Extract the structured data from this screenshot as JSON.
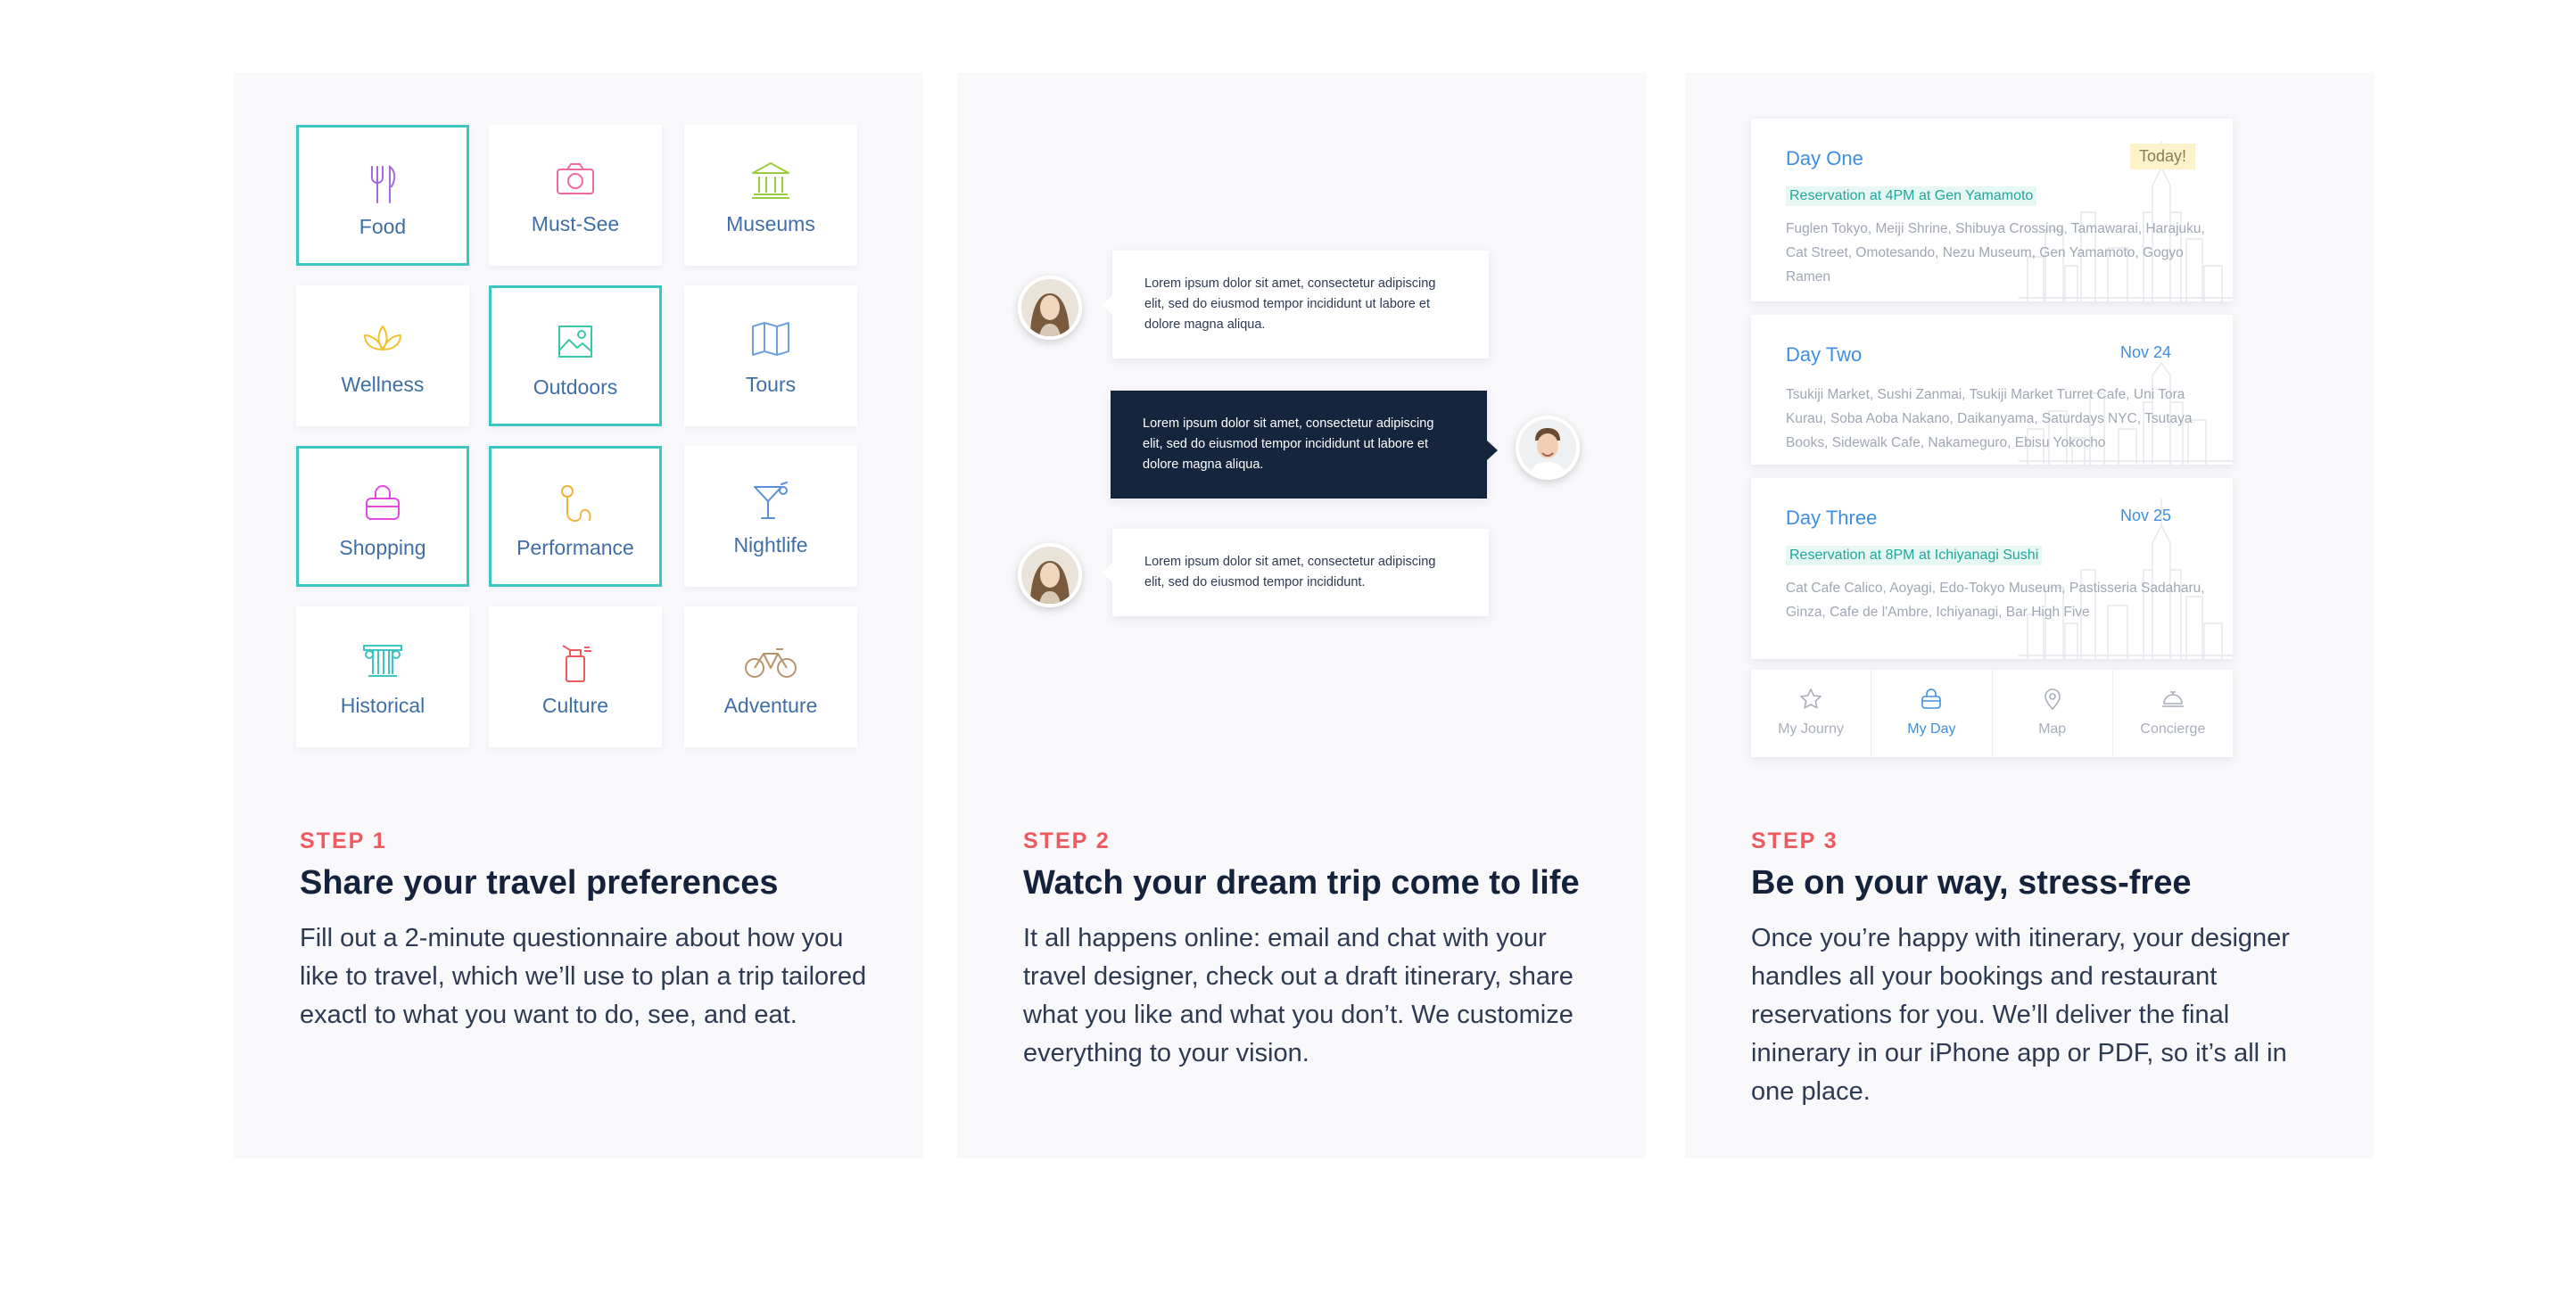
{
  "steps": [
    {
      "label": "STEP 1",
      "title": "Share your travel preferences",
      "description": "Fill out a 2-minute questionnaire about how you like to travel, which we’ll use to plan a trip tailored exactl to what you want to do, see, and eat."
    },
    {
      "label": "STEP 2",
      "title": "Watch your dream trip come to life",
      "description": "It all happens online: email and chat with your travel designer, check out a draft itinerary, share what you like and what you don’t. We customize everything to your vision."
    },
    {
      "label": "STEP 3",
      "title": "Be on your way, stress-free",
      "description": "Once you’re happy with itinerary, your designer handles all your bookings and restaurant reservations for you. We’ll deliver the final ininerary in our iPhone app or PDF, so it’s all in one place."
    }
  ],
  "categories": [
    {
      "label": "Food",
      "icon": "fork-knife-icon",
      "selected": true,
      "color": "#a36ae0"
    },
    {
      "label": "Must-See",
      "icon": "camera-icon",
      "selected": false,
      "color": "#f06aa0"
    },
    {
      "label": "Museums",
      "icon": "museum-icon",
      "selected": false,
      "color": "#9ccc3c"
    },
    {
      "label": "Wellness",
      "icon": "lotus-icon",
      "selected": false,
      "color": "#f2c22c"
    },
    {
      "label": "Outdoors",
      "icon": "landscape-icon",
      "selected": true,
      "color": "#3cc6a8"
    },
    {
      "label": "Tours",
      "icon": "map-icon",
      "selected": false,
      "color": "#6fa0e0"
    },
    {
      "label": "Shopping",
      "icon": "handbag-icon",
      "selected": true,
      "color": "#e44ae0"
    },
    {
      "label": "Performance",
      "icon": "microphone-icon",
      "selected": true,
      "color": "#f2b23c"
    },
    {
      "label": "Nightlife",
      "icon": "cocktail-icon",
      "selected": false,
      "color": "#5a8fd6"
    },
    {
      "label": "Historical",
      "icon": "column-icon",
      "selected": false,
      "color": "#3cc6c1"
    },
    {
      "label": "Culture",
      "icon": "spray-can-icon",
      "selected": false,
      "color": "#ef5a5f"
    },
    {
      "label": "Adventure",
      "icon": "bicycle-icon",
      "selected": false,
      "color": "#b8946a"
    }
  ],
  "chat": {
    "messages": [
      {
        "from": "traveler",
        "avatar_icon": "woman-avatar",
        "text": "Lorem ipsum dolor sit amet, consectetur adipiscing elit, sed do eiusmod tempor incididunt ut labore et dolore magna aliqua."
      },
      {
        "from": "designer",
        "avatar_icon": "man-avatar",
        "text": "Lorem ipsum dolor sit amet, consectetur adipiscing elit, sed do eiusmod tempor incididunt ut labore et dolore magna aliqua."
      },
      {
        "from": "traveler",
        "avatar_icon": "woman-avatar",
        "text": "Lorem ipsum dolor sit amet, consectetur adipiscing elit, sed do eiusmod tempor incididunt."
      }
    ]
  },
  "itinerary": {
    "days": [
      {
        "title": "Day One",
        "badge": "Today!",
        "reservation": "Reservation at 4PM at Gen Yamamoto",
        "places": "Fuglen Tokyo, Meiji Shrine, Shibuya Crossing, Tamawarai, Harajuku, Cat Street, Omotesando, Nezu Museum, Gen Yamamoto, Gogyo Ramen"
      },
      {
        "title": "Day Two",
        "date": "Nov 24",
        "places": "Tsukiji Market, Sushi Zanmai, Tsukiji Market Turret Cafe, Uni Tora Kurau, Soba Aoba Nakano, Daikanyama, Saturdays NYC, Tsutaya Books, Sidewalk Cafe, Nakameguro, Ebisu Yokocho"
      },
      {
        "title": "Day Three",
        "date": "Nov 25",
        "reservation": "Reservation at 8PM at Ichiyanagi Sushi",
        "places": "Cat Cafe Calico, Aoyagi, Edo-Tokyo Museum, Pastisseria Sadaharu, Ginza, Cafe de l'Ambre, Ichiyanagi, Bar High Five"
      }
    ],
    "tabs": [
      {
        "label": "My Journy",
        "icon": "star-icon",
        "active": false
      },
      {
        "label": "My Day",
        "icon": "bag-icon",
        "active": true
      },
      {
        "label": "Map",
        "icon": "map-pin-icon",
        "active": false
      },
      {
        "label": "Concierge",
        "icon": "service-bell-icon",
        "active": false
      }
    ]
  },
  "colors": {
    "accent_step": "#ef5a5f",
    "selected_border": "#3cc6c1",
    "link_blue": "#3e8fe0",
    "dark_bubble": "#15253e"
  }
}
